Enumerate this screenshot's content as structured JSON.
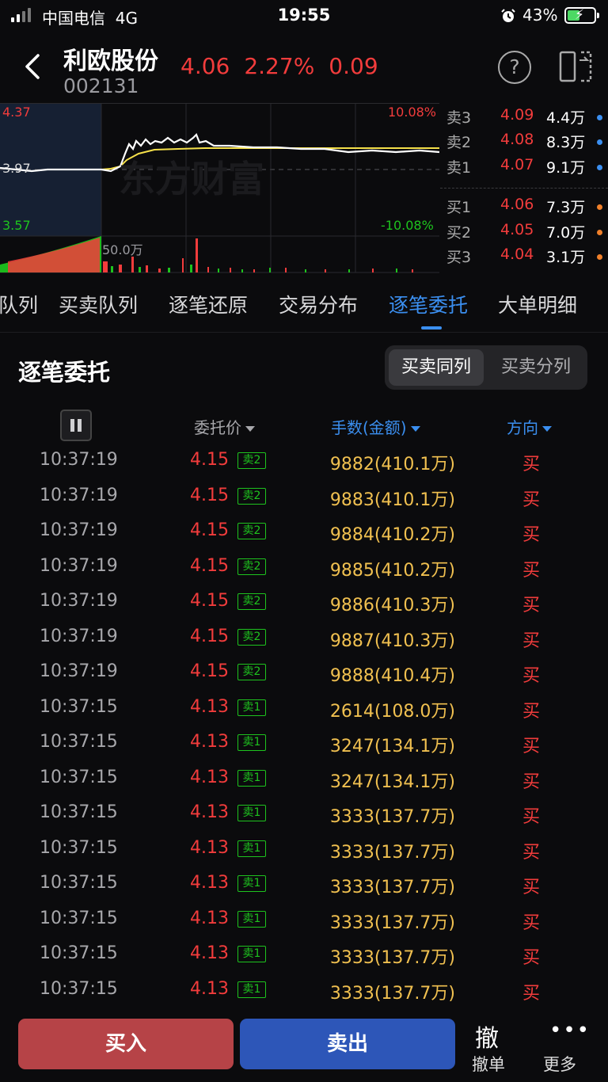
{
  "status": {
    "carrier": "中国电信",
    "network": "4G",
    "time": "19:55",
    "battery": "43%"
  },
  "header": {
    "name": "利欧股份",
    "code": "002131",
    "price": "4.06",
    "change_pct": "2.27%",
    "change": "0.09",
    "help": "?"
  },
  "chart": {
    "high_price": "4.37",
    "base_price": "3.97",
    "low_price": "3.57",
    "high_pct": "10.08%",
    "low_pct": "-10.08%",
    "volume_label": "50.0万",
    "watermark": "东方财富",
    "colors": {
      "price_line": "#ffffff",
      "avg_line": "#f5e04a",
      "up": "#f23c3c",
      "down": "#1ec31e"
    }
  },
  "orderbook": {
    "asks": [
      {
        "label": "卖3",
        "price": "4.09",
        "volume": "4.4万"
      },
      {
        "label": "卖2",
        "price": "4.08",
        "volume": "8.3万"
      },
      {
        "label": "卖1",
        "price": "4.07",
        "volume": "9.1万"
      }
    ],
    "bids": [
      {
        "label": "买1",
        "price": "4.06",
        "volume": "7.3万"
      },
      {
        "label": "买2",
        "price": "4.05",
        "volume": "7.0万"
      },
      {
        "label": "买3",
        "price": "4.04",
        "volume": "3.1万"
      }
    ]
  },
  "tabs": [
    "队列",
    "买卖队列",
    "逐笔还原",
    "交易分布",
    "逐笔委托",
    "大单明细"
  ],
  "active_tab": "逐笔委托",
  "section": {
    "title": "逐笔委托",
    "segments": [
      "买卖同列",
      "买卖分列"
    ]
  },
  "columns": {
    "price": "委托价",
    "amount": "手数(金额)",
    "direction": "方向"
  },
  "rows": [
    {
      "time": "10:37:19",
      "price": "4.15",
      "tag": "卖2",
      "amount": "9882(410.1万)",
      "dir": "买"
    },
    {
      "time": "10:37:19",
      "price": "4.15",
      "tag": "卖2",
      "amount": "9883(410.1万)",
      "dir": "买"
    },
    {
      "time": "10:37:19",
      "price": "4.15",
      "tag": "卖2",
      "amount": "9884(410.2万)",
      "dir": "买"
    },
    {
      "time": "10:37:19",
      "price": "4.15",
      "tag": "卖2",
      "amount": "9885(410.2万)",
      "dir": "买"
    },
    {
      "time": "10:37:19",
      "price": "4.15",
      "tag": "卖2",
      "amount": "9886(410.3万)",
      "dir": "买"
    },
    {
      "time": "10:37:19",
      "price": "4.15",
      "tag": "卖2",
      "amount": "9887(410.3万)",
      "dir": "买"
    },
    {
      "time": "10:37:19",
      "price": "4.15",
      "tag": "卖2",
      "amount": "9888(410.4万)",
      "dir": "买"
    },
    {
      "time": "10:37:15",
      "price": "4.13",
      "tag": "卖1",
      "amount": "2614(108.0万)",
      "dir": "买"
    },
    {
      "time": "10:37:15",
      "price": "4.13",
      "tag": "卖1",
      "amount": "3247(134.1万)",
      "dir": "买"
    },
    {
      "time": "10:37:15",
      "price": "4.13",
      "tag": "卖1",
      "amount": "3247(134.1万)",
      "dir": "买"
    },
    {
      "time": "10:37:15",
      "price": "4.13",
      "tag": "卖1",
      "amount": "3333(137.7万)",
      "dir": "买"
    },
    {
      "time": "10:37:15",
      "price": "4.13",
      "tag": "卖1",
      "amount": "3333(137.7万)",
      "dir": "买"
    },
    {
      "time": "10:37:15",
      "price": "4.13",
      "tag": "卖1",
      "amount": "3333(137.7万)",
      "dir": "买"
    },
    {
      "time": "10:37:15",
      "price": "4.13",
      "tag": "卖1",
      "amount": "3333(137.7万)",
      "dir": "买"
    },
    {
      "time": "10:37:15",
      "price": "4.13",
      "tag": "卖1",
      "amount": "3333(137.7万)",
      "dir": "买"
    },
    {
      "time": "10:37:15",
      "price": "4.13",
      "tag": "卖1",
      "amount": "3333(137.7万)",
      "dir": "买"
    }
  ],
  "bottom": {
    "buy": "买入",
    "sell": "卖出",
    "cancel_glyph": "撤",
    "cancel": "撤单",
    "more_glyph": "•••",
    "more": "更多"
  }
}
